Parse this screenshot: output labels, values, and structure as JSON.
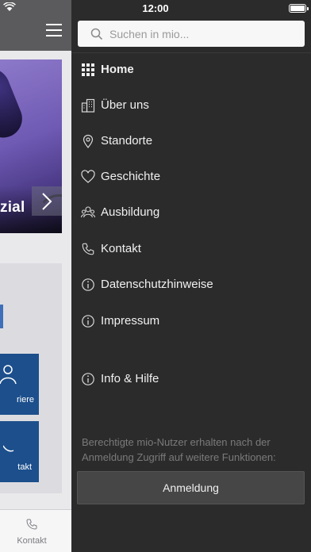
{
  "status_bar": {
    "time": "12:00"
  },
  "search": {
    "placeholder": "Suchen in mio..."
  },
  "nav": {
    "items": [
      {
        "label": "Home",
        "icon": "grid-icon",
        "active": true
      },
      {
        "label": "Über uns",
        "icon": "building-icon"
      },
      {
        "label": "Standorte",
        "icon": "location-pin-icon"
      },
      {
        "label": "Geschichte",
        "icon": "heart-icon"
      },
      {
        "label": "Ausbildung",
        "icon": "people-icon"
      },
      {
        "label": "Kontakt",
        "icon": "phone-icon"
      },
      {
        "label": "Datenschutzhinweise",
        "icon": "info-icon"
      },
      {
        "label": "Impressum",
        "icon": "info-icon"
      },
      {
        "label": "Info & Hilfe",
        "icon": "info-icon"
      }
    ]
  },
  "drawer_note": "Berechtigte mio-Nutzer erhalten nach der Anmeldung Zugriff auf weitere Funktionen:",
  "login_button": "Anmeldung",
  "background_app": {
    "hero_title": "zial",
    "tiles": [
      {
        "label": "riere"
      },
      {
        "label": "takt"
      }
    ],
    "tabbar": {
      "kontakt_label": "Kontakt"
    }
  },
  "colors": {
    "drawer_bg": "#2b2b2b",
    "header_bg": "#5b5b5d",
    "tile_blue": "#1c4f8c",
    "button_bg": "#464646"
  }
}
